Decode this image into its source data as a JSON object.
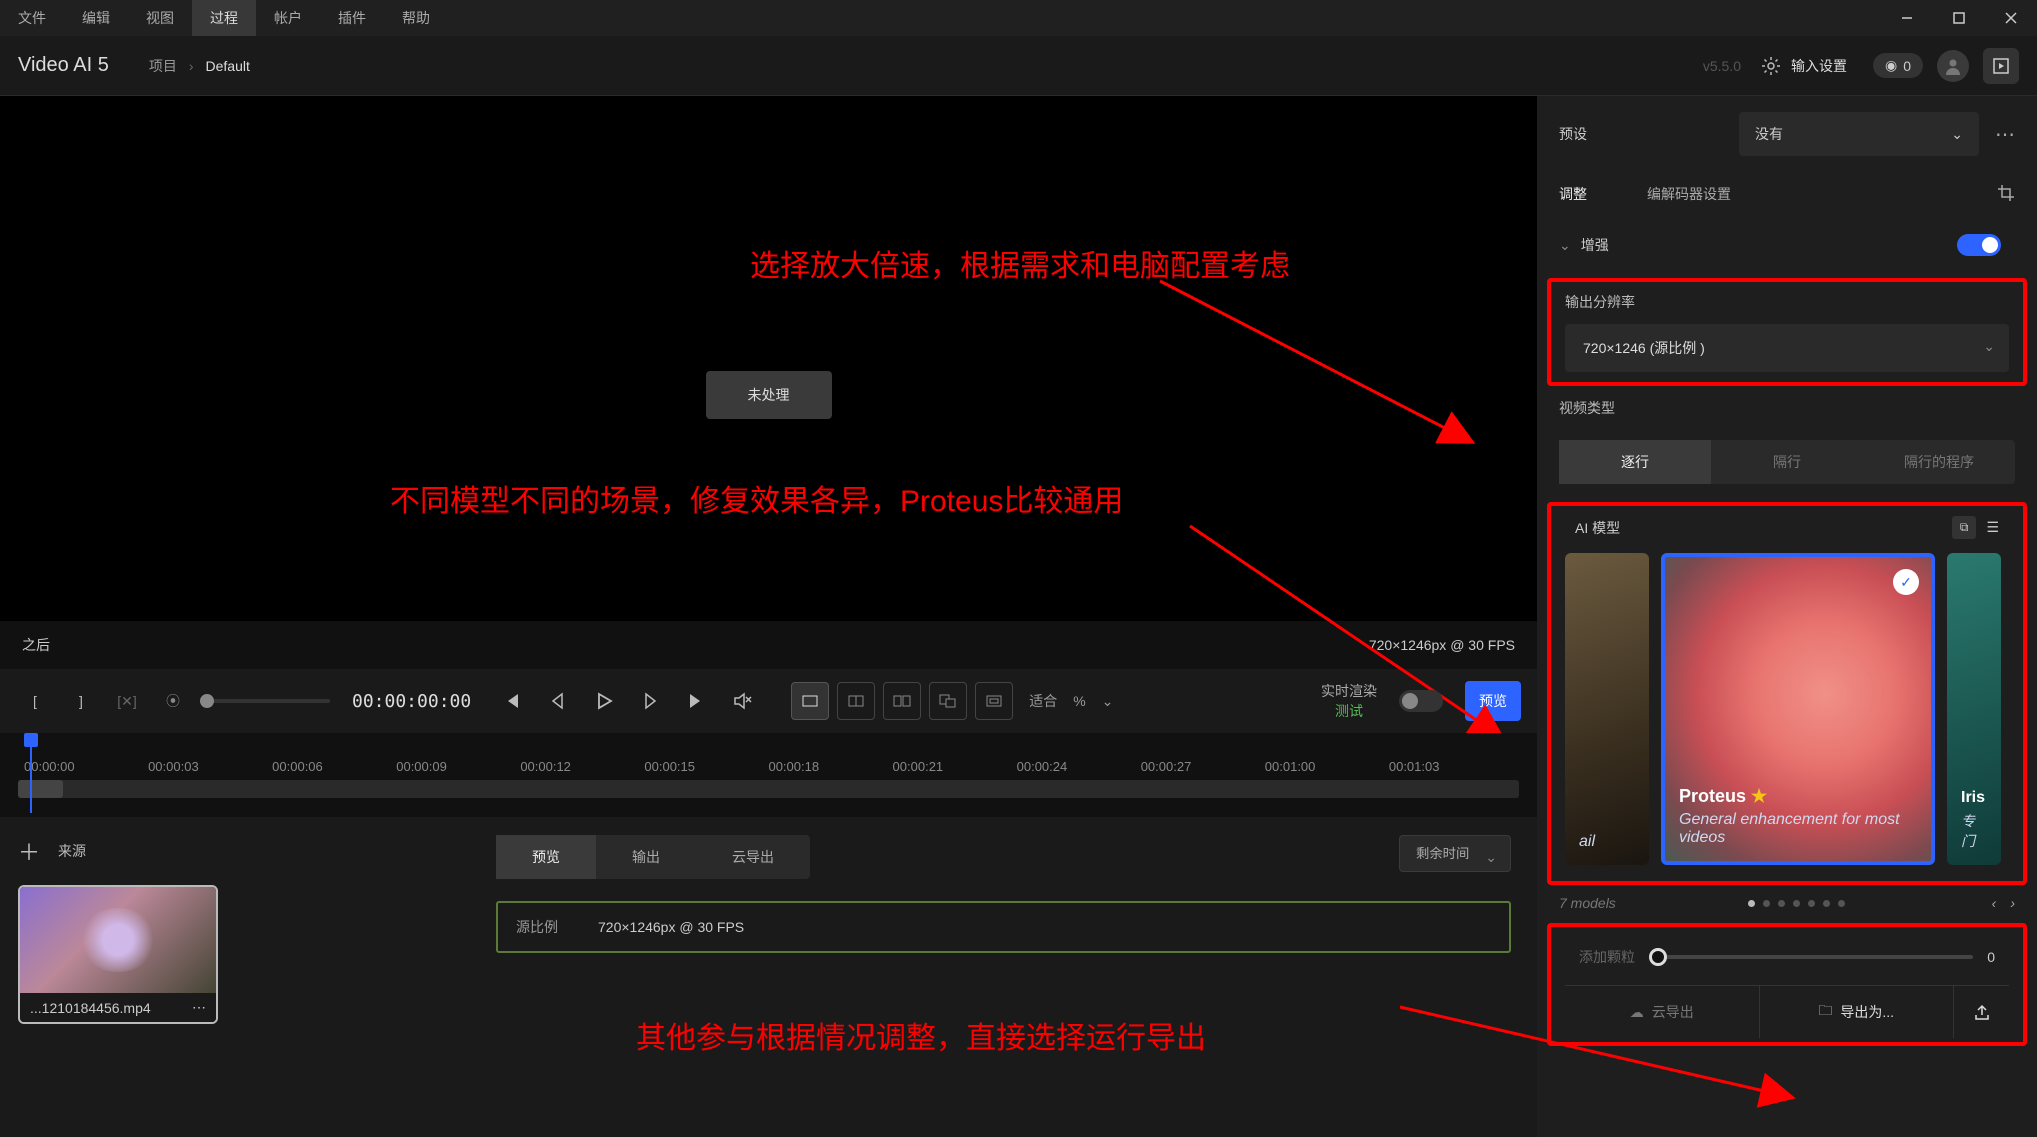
{
  "menubar": {
    "items": [
      "文件",
      "编辑",
      "视图",
      "过程",
      "帐户",
      "插件",
      "帮助"
    ],
    "active_index": 3
  },
  "toolbar": {
    "app_title": "Video AI  5",
    "crumb_project": "项目",
    "crumb_default": "Default",
    "version": "v5.5.0",
    "input_settings": "输入设置",
    "credits": "0"
  },
  "preview": {
    "chip": "未处理",
    "after_label": "之后",
    "resolution": "720×1246px @ 30 FPS"
  },
  "annotations": {
    "a1": "选择放大倍速，根据需求和电脑配置考虑",
    "a2": "不同模型不同的场景，修复效果各异，Proteus比较通用",
    "a3": "其他参与根据情况调整，直接选择运行导出"
  },
  "transport": {
    "timecode": "00:00:00:00",
    "fit_label": "适合",
    "fit_pct": "%",
    "realtime_label": "实时渲染",
    "realtime_test": "测试",
    "preview_btn": "预览"
  },
  "timeline": {
    "ticks": [
      "00:00:00",
      "00:00:03",
      "00:00:06",
      "00:00:09",
      "00:00:12",
      "00:00:15",
      "00:00:18",
      "00:00:21",
      "00:00:24",
      "00:00:27",
      "00:01:00",
      "00:01:03"
    ]
  },
  "sources": {
    "add": "＋",
    "title": "来源",
    "clip_name": "...1210184456.mp4"
  },
  "output": {
    "tabs": [
      "预览",
      "输出",
      "云导出"
    ],
    "active_tab": 0,
    "ratio_label": "源比例",
    "ratio_value": "720×1246px @ 30 FPS",
    "remaining": "剩余时间"
  },
  "panel": {
    "preset_label": "预设",
    "preset_value": "没有",
    "tabs": {
      "adjust": "调整",
      "codec": "编解码器设置"
    },
    "enhance": "增强",
    "out_res_label": "输出分辨率",
    "out_res_value": "720×1246 (源比例     )",
    "video_type_label": "视频类型",
    "video_type_opts": [
      "逐行",
      "隔行",
      "隔行的程序"
    ],
    "video_type_active": 0,
    "ai_model_label": "AI 模型",
    "models": {
      "selected": {
        "name": "Proteus",
        "desc": "General enhancement for most videos"
      },
      "partial_left": "ail",
      "partial_right_name": "Iris",
      "partial_right_desc": "专门"
    },
    "models_count": "7 models",
    "grain_label": "添加颗粒",
    "grain_value": "0",
    "cloud_export": "云导出",
    "export_as": "导出为..."
  }
}
